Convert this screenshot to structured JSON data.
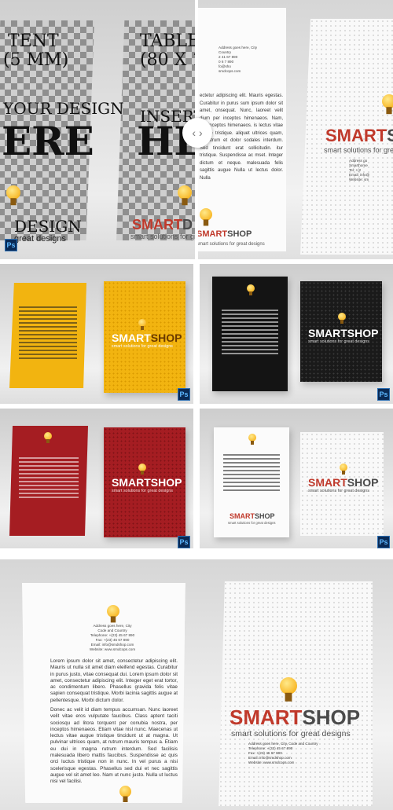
{
  "panel1": {
    "left_top": "TENT",
    "left_size": "(5 MM)",
    "left_insert": "YOUR DESIGN",
    "left_big": "ERE",
    "left_bottom": "DESIGN",
    "right_top": "TABLE",
    "right_size": "(80 X 1",
    "right_insert": "INSERT YOU",
    "right_big": "HE",
    "right_logo_smart": "SMART",
    "right_logo_shop": "D",
    "right_tagline": "smart solutions for great designs",
    "left_tagline": "great designs",
    "address_block": "Address goes here, City\nCountry\n2 41 67 890\n0 6 7 890\nfo@sho\nsmdcops.com",
    "card_text": "ectetur adipiscing elit. Mauris egestas. Curabitur in purus sum ipsum dolor sit amet, onsequat. Nunc, laoreet velit dium per inceptos himenaeos. Nam, per inceptos himenaeos. is lectus vitae augue tristique. aliquet ultrices quam, at rutrum et dolor sodales interdum. Sed tincidunt erat sollicitudin. itur tristique. Suspendisse ac mset. Integer dictum et neque. malesuada felis sagittis augue Nulla ut lectus dolor. Nulla",
    "right_address": "Address go\nSmarthome\nTel: +(2\nEmail: info@\nWebsite: sm",
    "handle_glyph": "‹ ›"
  },
  "panel6": {
    "address_block": "Address goes here, City\nCode and Country\nTelephone: +(23) 45 67 890\nFax: +(23) 45 67 890\nEmail: info@smdshop.com\nWebsite: www.smdcops.com",
    "paragraph1": "Lorem ipsum dolor sit amet, consectetur adipiscing elit. Mauris ut nulla sit amet diam eleifend egestas. Curabitur in purus justo, vitae consequat dui. Lorem ipsum dolor sit amet, consectetur adipiscing elit. Integer eget erat tortor, ac condimentum libero. Phasellus gravida felis vitae sapien consequat tristique. Morbi lacinia sagittis augue at pellentesque. Morbi dictum dolor.",
    "paragraph2": "Donec ac velit id diam tempus accumsan. Nunc laoreet velit vitae eros vulputate faucibus. Class aptent taciti sociosqu ad litora torquent per conubia nostra, per inceptos himenaeos. Etiam vitae nisl nunc. Maecenas ut lectus vitae augue tristique tincidunt ut at magna. Ut pulvinar ultrices quam, at rutrum mauris tempus a. Etiam eu dui in magna rutrum interdum. Sed facilisis malesuada libero mattis faucibus. Suspendisse ac quis orci luctus tristique non in nunc. In vel purus a nisi scelerisque egestas. Phasellus sed dui et nec sagittis augue vel sit amet leo. Nam ut nunc justo. Nulla ut luctus nisi vel facilisi.",
    "logo_smart": "SMART",
    "logo_shop": "SHOP",
    "tagline": "smart solutions for great designs",
    "right_address": "Address goes here, City, Code and Country\nTelephone: +(23) 45 67 890\nFax: +(23) 45 67 890\nEmail: info@smdshop.com\nWebsite: www.smdcops.com"
  },
  "mini": {
    "logo_smart": "SMART",
    "logo_shop": "SHOP",
    "tagline": "smart solutions for great designs"
  },
  "ps_badge": "Ps",
  "colors": {
    "brand_red": "#c0392b",
    "yellow": "#f2b410",
    "black": "#141414",
    "red": "#a51d22"
  }
}
